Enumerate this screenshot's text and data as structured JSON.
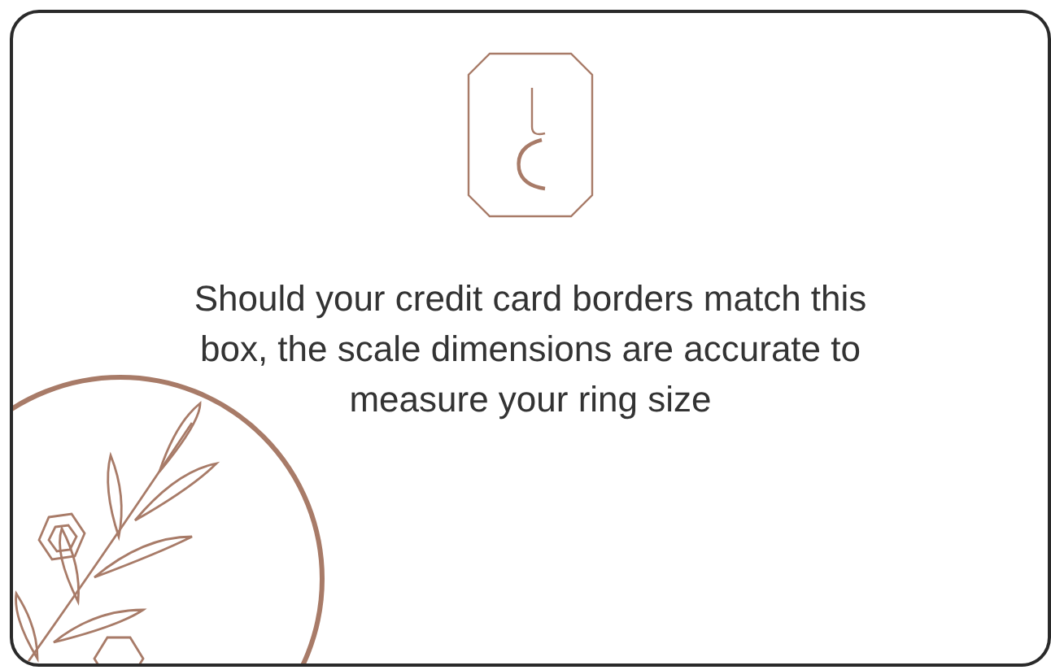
{
  "message": "Should your credit card borders match this box, the scale dimensions are accurate to measure your ring size"
}
